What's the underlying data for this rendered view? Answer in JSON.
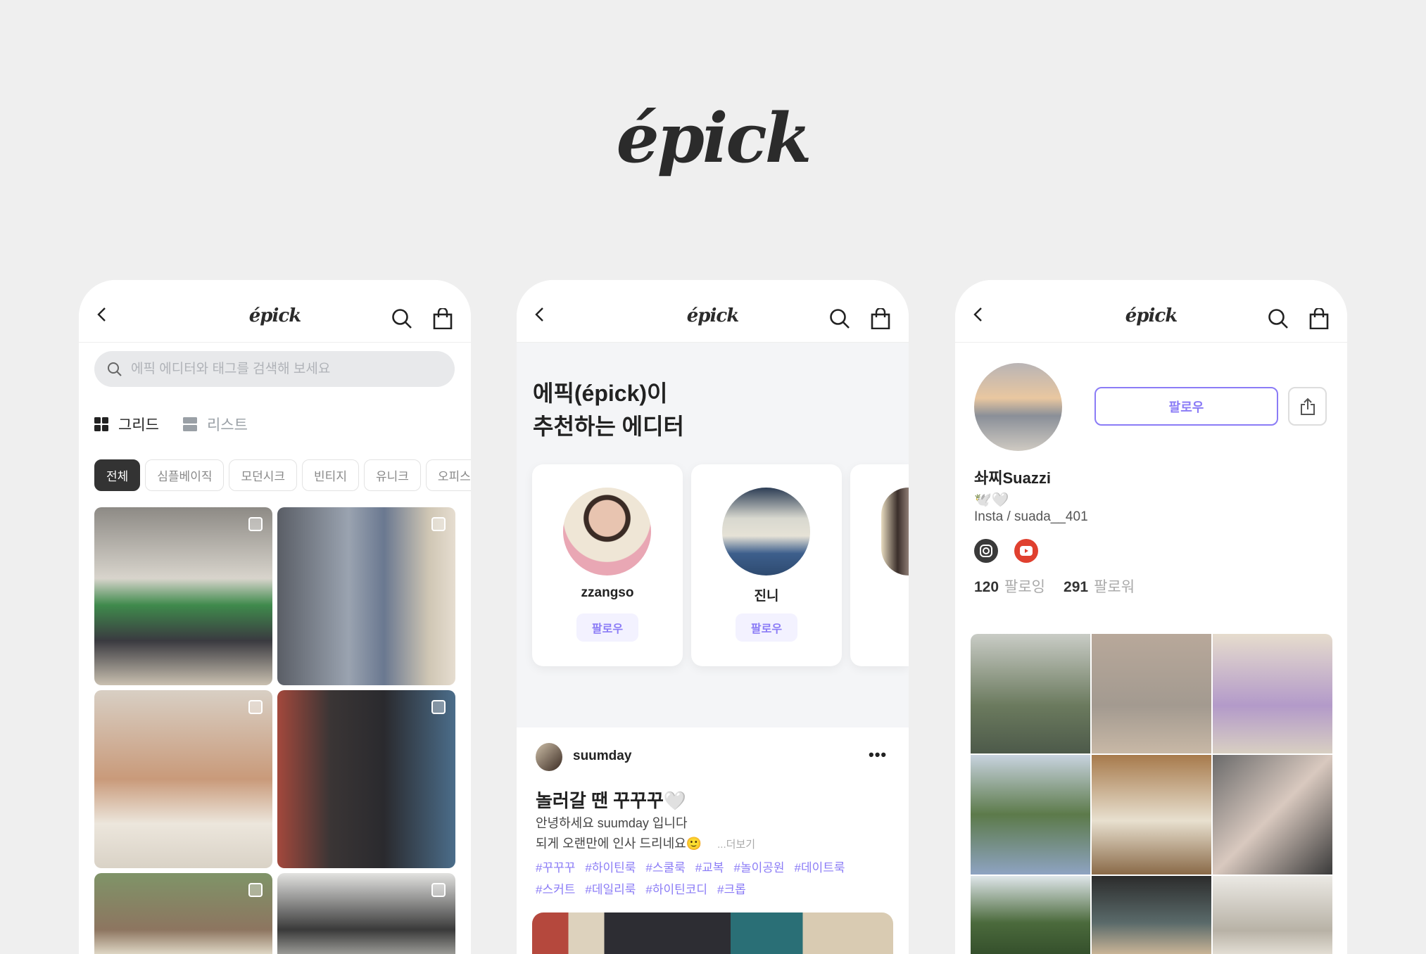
{
  "brand": {
    "logo": "épick"
  },
  "header": {
    "logo": "épick"
  },
  "panel_grid": {
    "search_placeholder": "에픽 에디터와 태그를 검색해 보세요",
    "view_grid": "그리드",
    "view_list": "리스트",
    "chips": [
      "전체",
      "심플베이직",
      "모던시크",
      "빈티지",
      "유니크",
      "오피스"
    ]
  },
  "panel_recommend": {
    "title_line1": "에픽(épick)이",
    "title_line2": "추천하는 에디터",
    "editors": [
      {
        "name": "zzangso",
        "follow": "팔로우"
      },
      {
        "name": "진니",
        "follow": "팔로우"
      }
    ],
    "post": {
      "user": "suumday",
      "more": "•••",
      "title": "놀러갈 땐 꾸꾸꾸🤍",
      "line1": "안녕하세요 suumday 입니다",
      "line2": "되게 오랜만에 인사 드리네요🙂",
      "more_link": "...더보기",
      "tags": [
        "#꾸꾸꾸",
        "#하이틴룩",
        "#스쿨룩",
        "#교복",
        "#놀이공원",
        "#데이트룩",
        "#스커트",
        "#데일리룩",
        "#하이틴코디",
        "#크롭"
      ]
    }
  },
  "panel_profile": {
    "follow": "팔로우",
    "name": "솨찌Suazzi",
    "emoji": "🕊️🤍",
    "insta": "Insta / suada__401",
    "following_count": "120",
    "following_label": "팔로잉",
    "follower_count": "291",
    "follower_label": "팔로워"
  },
  "colors": {
    "accent": "#8b7cf6",
    "youtube": "#e0402f",
    "bg": "#efefef"
  }
}
